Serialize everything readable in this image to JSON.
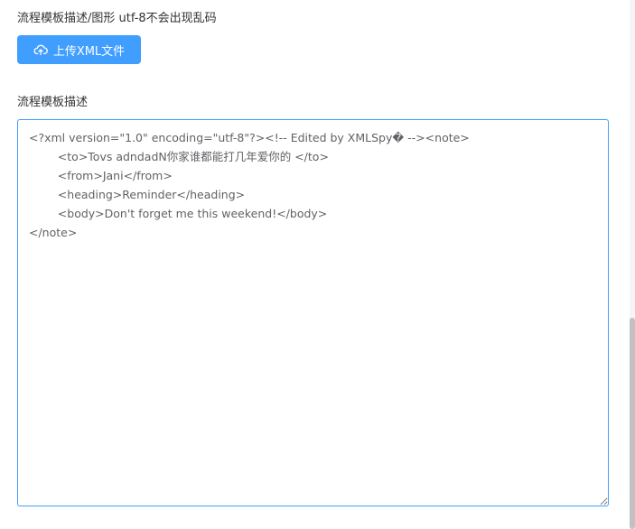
{
  "upload": {
    "label": "流程模板描述/图形 utf-8不会出现乱码",
    "button_label": "上传XML文件",
    "button_icon": "upload-cloud-icon",
    "button_color": "#409eff"
  },
  "description": {
    "label": "流程模板描述",
    "value": "<?xml version=\"1.0\" encoding=\"utf-8\"?><!-- Edited by XMLSpy� --><note>\n\t<to>Tovs adndadN你家谁都能打几年爱你的 </to>\n\t<from>Jani</from>\n\t<heading>Reminder</heading>\n\t<body>Don't forget me this weekend!</body>\n</note>"
  }
}
